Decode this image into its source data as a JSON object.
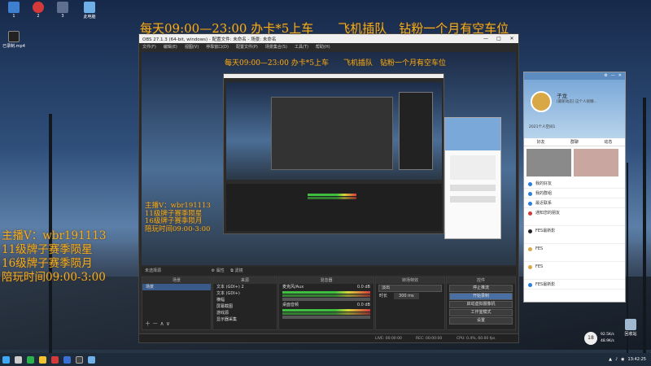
{
  "overlay": {
    "top_banner": "每天09:00—23:00 办卡*5上车　　飞机插队　钻粉一个月有空车位",
    "streamer_lines": [
      "主播V：wbr191113",
      "11级牌子赛季陨星",
      "16级牌子赛季陨月",
      "陪玩时间09:00-3:00"
    ]
  },
  "desktop_icons": [
    {
      "label": "1"
    },
    {
      "label": "2"
    },
    {
      "label": "3"
    },
    {
      "label": "此电脑"
    },
    {
      "label": "已录制.mp4"
    },
    {
      "label": "回收站"
    }
  ],
  "obs": {
    "title": "OBS 27.1.3 (64-bit, windows) - 配置文件: 未命名 - 场景: 未命名",
    "menu": [
      "文件(F)",
      "编辑(E)",
      "视图(V)",
      "停靠窗口(D)",
      "配置文件(P)",
      "场景集合(S)",
      "工具(T)",
      "帮助(H)"
    ],
    "controls": {
      "min": "—",
      "max": "□",
      "close": "✕"
    },
    "mode_bar": {
      "props": "属性",
      "filters": "滤镜"
    },
    "source_label": "未选择源",
    "scenes": {
      "title": "场景",
      "items": [
        "场景"
      ]
    },
    "sources": {
      "title": "来源",
      "items": [
        "文本 (GDI+) 2",
        "文本 (GDI+)",
        "横幅",
        "屏幕截图",
        "游戏源",
        "显示器采集"
      ]
    },
    "mixer": {
      "title": "混音器",
      "channels": [
        {
          "name": "麦克风/Aux",
          "db": "0.0 dB"
        },
        {
          "name": "桌面音频",
          "db": "0.0 dB"
        }
      ]
    },
    "transitions": {
      "title": "转场特效",
      "type": "淡出",
      "duration_label": "时长",
      "duration": "300 ms"
    },
    "controls_dock": {
      "title": "控件",
      "buttons": [
        "停止推流",
        "开始录制",
        "启动虚拟摄像机",
        "工作室模式",
        "设置",
        "退出"
      ]
    },
    "statusbar": {
      "live": "LIVE: 00:00:00",
      "rec": "REC: 00:00:00",
      "cpu": "CPU: 0.4%, 60.00 fps"
    }
  },
  "qq": {
    "name": "子龙",
    "signature": "[最新动态] 这个人很懒...",
    "tabs": [
      "好友",
      "群聊",
      "动态"
    ],
    "items": [
      "我的好友",
      "我的群组",
      "最近联系",
      "通知",
      "FES最新影",
      "FES",
      "FES",
      "FES最新影"
    ],
    "chat_snippet": "通知您的朋友",
    "date": "2021个人空间1"
  },
  "taskbar": {
    "time": "13:42:25",
    "network": "92.5K/s",
    "upload": "48.9K/s",
    "counter": "18"
  },
  "colors": {
    "overlay": "#f0b020",
    "obs_bg": "#2b2b2b",
    "accent": "#4a6fa5"
  }
}
